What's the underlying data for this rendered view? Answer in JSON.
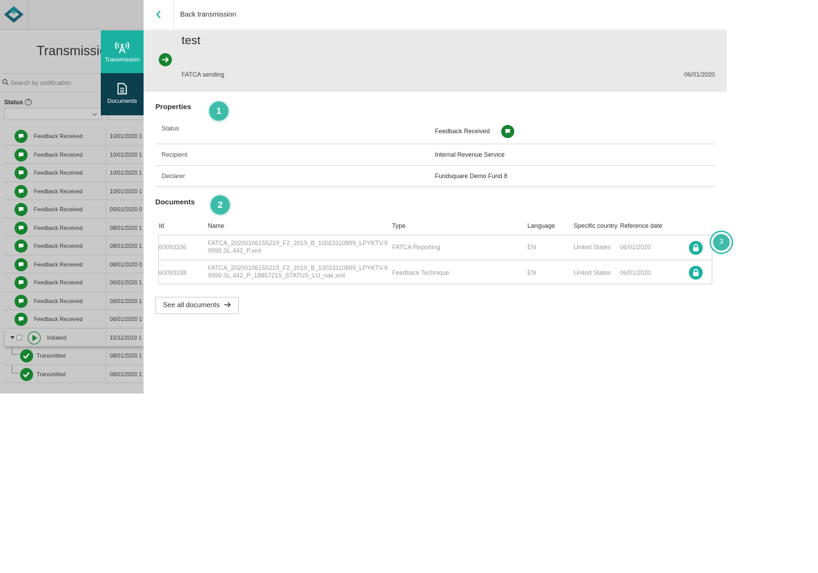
{
  "left_pane": {
    "title": "Transmissio",
    "search_placeholder": "Search by codification",
    "status_filter_label": "Status",
    "help_icon_glyph": "?",
    "rows": [
      {
        "label": "Feedback Received",
        "date": "10/01/2020 1",
        "icon": "feedback-icon"
      },
      {
        "label": "Feedback Received",
        "date": "10/01/2020 1",
        "icon": "feedback-icon"
      },
      {
        "label": "Feedback Received",
        "date": "10/01/2020 1",
        "icon": "feedback-icon"
      },
      {
        "label": "Feedback Received",
        "date": "10/01/2020 1",
        "icon": "feedback-icon"
      },
      {
        "label": "Feedback Received",
        "date": "09/01/2020 0",
        "icon": "feedback-icon"
      },
      {
        "label": "Feedback Received",
        "date": "08/01/2020 1",
        "icon": "feedback-icon"
      },
      {
        "label": "Feedback Received",
        "date": "08/01/2020 1",
        "icon": "feedback-icon"
      },
      {
        "label": "Feedback Received",
        "date": "08/01/2020 0",
        "icon": "feedback-icon"
      },
      {
        "label": "Feedback Received",
        "date": "06/01/2020 1",
        "icon": "feedback-icon"
      },
      {
        "label": "Feedback Received",
        "date": "06/01/2020 1",
        "icon": "feedback-icon"
      },
      {
        "label": "Feedback Received",
        "date": "06/01/2020 1",
        "icon": "feedback-icon"
      },
      {
        "label": "Initiated",
        "date": "15/11/2019 1",
        "icon": "play-icon"
      },
      {
        "label": "Transmitted",
        "date": "08/01/2020 1",
        "icon": "check-icon"
      },
      {
        "label": "Transmitted",
        "date": "08/01/2020 1",
        "icon": "check-icon"
      }
    ]
  },
  "tabs": {
    "transmission": {
      "label": "Transmission",
      "icon": "antenna-icon"
    },
    "documents": {
      "label": "Documents",
      "icon": "document-icon"
    }
  },
  "detail": {
    "back_label": "Back transmission",
    "title": "test",
    "subtitle": "FATCA sending",
    "date": "06/01/2020",
    "properties_title": "Properties",
    "properties": [
      {
        "label": "Status",
        "value": "Feedback Received"
      },
      {
        "label": "Recipient",
        "value": "Internal Revenue Service"
      },
      {
        "label": "Declarer",
        "value": "Fundsquare Demo Fund 8"
      }
    ],
    "documents_title": "Documents",
    "document_columns": [
      "Id",
      "Name",
      "Type",
      "Language",
      "Specific country",
      "Reference date"
    ],
    "documents": [
      {
        "id": "60093336",
        "name": "FATCA_20200106155219_F2_2019_B_10023110899_LPYKTV.99999.SL.442_P.xml",
        "type": "FATCA Reporting",
        "language": "EN",
        "country": "United States",
        "reference_date": "06/01/2020"
      },
      {
        "id": "60093338",
        "name": "FATCA_20200106155219_F2_2019_B_10023110899_LPYKTV.99999.SL.442_P_18857215_STATUS_LU_nak.xml",
        "type": "Feedback Technique",
        "language": "EN",
        "country": "United States",
        "reference_date": "06/01/2020"
      }
    ],
    "see_all_label": "See all documents"
  },
  "badges": {
    "one": "1",
    "two": "2",
    "three": "3"
  },
  "colors": {
    "accent": "#1bb1a0",
    "dark_tab": "#0c3f4d",
    "status_green": "#17832f",
    "badge": "#3dbca9"
  }
}
